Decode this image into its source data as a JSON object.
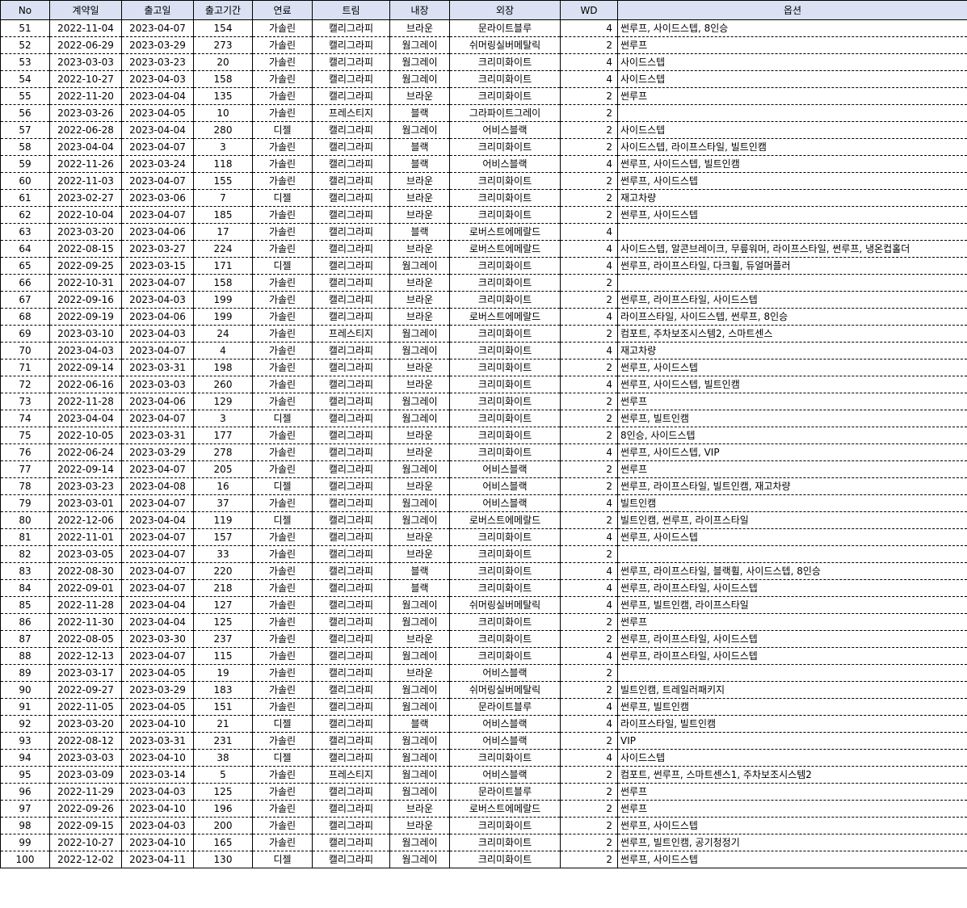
{
  "columns": [
    "No",
    "계약일",
    "출고일",
    "출고기간",
    "연료",
    "트림",
    "내장",
    "외장",
    "WD",
    "옵션"
  ],
  "rows": [
    [
      "51",
      "2022-11-04",
      "2023-04-07",
      "154",
      "가솔린",
      "캘리그라피",
      "브라운",
      "문라이트블루",
      "4",
      "썬루프, 사이드스텝, 8인승"
    ],
    [
      "52",
      "2022-06-29",
      "2023-03-29",
      "273",
      "가솔린",
      "캘리그라피",
      "웜그레이",
      "쉬머링실버메탈릭",
      "2",
      "썬루프"
    ],
    [
      "53",
      "2023-03-03",
      "2023-03-23",
      "20",
      "가솔린",
      "캘리그라피",
      "웜그레이",
      "크리미화이트",
      "4",
      "사이드스텝"
    ],
    [
      "54",
      "2022-10-27",
      "2023-04-03",
      "158",
      "가솔린",
      "캘리그라피",
      "웜그레이",
      "크리미화이트",
      "4",
      "사이드스텝"
    ],
    [
      "55",
      "2022-11-20",
      "2023-04-04",
      "135",
      "가솔린",
      "캘리그라피",
      "브라운",
      "크리미화이트",
      "2",
      "썬루프"
    ],
    [
      "56",
      "2023-03-26",
      "2023-04-05",
      "10",
      "가솔린",
      "프레스티지",
      "블랙",
      "그라파이트그레이",
      "2",
      ""
    ],
    [
      "57",
      "2022-06-28",
      "2023-04-04",
      "280",
      "디젤",
      "캘리그라피",
      "웜그레이",
      "어비스블랙",
      "2",
      "사이드스텝"
    ],
    [
      "58",
      "2023-04-04",
      "2023-04-07",
      "3",
      "가솔린",
      "캘리그라피",
      "블랙",
      "크리미화이트",
      "2",
      "사이드스텝, 라이프스타일, 빌트인캠"
    ],
    [
      "59",
      "2022-11-26",
      "2023-03-24",
      "118",
      "가솔린",
      "캘리그라피",
      "블랙",
      "어비스블랙",
      "4",
      "썬루프, 사이드스텝, 빌트인캠"
    ],
    [
      "60",
      "2022-11-03",
      "2023-04-07",
      "155",
      "가솔린",
      "캘리그라피",
      "브라운",
      "크리미화이트",
      "2",
      "썬루프, 사이드스텝"
    ],
    [
      "61",
      "2023-02-27",
      "2023-03-06",
      "7",
      "디젤",
      "캘리그라피",
      "브라운",
      "크리미화이트",
      "2",
      "재고차량"
    ],
    [
      "62",
      "2022-10-04",
      "2023-04-07",
      "185",
      "가솔린",
      "캘리그라피",
      "브라운",
      "크리미화이트",
      "2",
      "썬루프, 사이드스텝"
    ],
    [
      "63",
      "2023-03-20",
      "2023-04-06",
      "17",
      "가솔린",
      "캘리그라피",
      "블랙",
      "로버스트에메랄드",
      "4",
      ""
    ],
    [
      "64",
      "2022-08-15",
      "2023-03-27",
      "224",
      "가솔린",
      "캘리그라피",
      "브라운",
      "로버스트에메랄드",
      "4",
      "사이드스텝, 알콘브레이크, 무릎워머, 라이프스타일, 썬루프, 냉온컵홀더"
    ],
    [
      "65",
      "2022-09-25",
      "2023-03-15",
      "171",
      "디젤",
      "캘리그라피",
      "웜그레이",
      "크리미화이트",
      "4",
      "썬루프, 라이프스타일, 다크휠, 듀얼머플러"
    ],
    [
      "66",
      "2022-10-31",
      "2023-04-07",
      "158",
      "가솔린",
      "캘리그라피",
      "브라운",
      "크리미화이트",
      "2",
      ""
    ],
    [
      "67",
      "2022-09-16",
      "2023-04-03",
      "199",
      "가솔린",
      "캘리그라피",
      "브라운",
      "크리미화이트",
      "2",
      "썬루프, 라이프스타일, 사이드스텝"
    ],
    [
      "68",
      "2022-09-19",
      "2023-04-06",
      "199",
      "가솔린",
      "캘리그라피",
      "브라운",
      "로버스트에메랄드",
      "4",
      "라이프스타일, 사이드스텝, 썬루프, 8인승"
    ],
    [
      "69",
      "2023-03-10",
      "2023-04-03",
      "24",
      "가솔린",
      "프레스티지",
      "웜그레이",
      "크리미화이트",
      "2",
      "컴포트, 주차보조시스템2, 스마트센스"
    ],
    [
      "70",
      "2023-04-03",
      "2023-04-07",
      "4",
      "가솔린",
      "캘리그라피",
      "웜그레이",
      "크리미화이트",
      "4",
      "재고차량"
    ],
    [
      "71",
      "2022-09-14",
      "2023-03-31",
      "198",
      "가솔린",
      "캘리그라피",
      "브라운",
      "크리미화이트",
      "2",
      "썬루프, 사이드스텝"
    ],
    [
      "72",
      "2022-06-16",
      "2023-03-03",
      "260",
      "가솔린",
      "캘리그라피",
      "브라운",
      "크리미화이트",
      "4",
      "썬루프, 사이드스텝, 빌트인캠"
    ],
    [
      "73",
      "2022-11-28",
      "2023-04-06",
      "129",
      "가솔린",
      "캘리그라피",
      "웜그레이",
      "크리미화이트",
      "2",
      "썬루프"
    ],
    [
      "74",
      "2023-04-04",
      "2023-04-07",
      "3",
      "디젤",
      "캘리그라피",
      "웜그레이",
      "크리미화이트",
      "2",
      "썬루프, 빌트인캠"
    ],
    [
      "75",
      "2022-10-05",
      "2023-03-31",
      "177",
      "가솔린",
      "캘리그라피",
      "브라운",
      "크리미화이트",
      "2",
      "8인승, 사이드스텝"
    ],
    [
      "76",
      "2022-06-24",
      "2023-03-29",
      "278",
      "가솔린",
      "캘리그라피",
      "브라운",
      "크리미화이트",
      "4",
      "썬루프, 사이드스텝, VIP"
    ],
    [
      "77",
      "2022-09-14",
      "2023-04-07",
      "205",
      "가솔린",
      "캘리그라피",
      "웜그레이",
      "어비스블랙",
      "2",
      "썬루프"
    ],
    [
      "78",
      "2023-03-23",
      "2023-04-08",
      "16",
      "디젤",
      "캘리그라피",
      "브라운",
      "어비스블랙",
      "2",
      "썬루프, 라이프스타일, 빌트인캠, 재고차량"
    ],
    [
      "79",
      "2023-03-01",
      "2023-04-07",
      "37",
      "가솔린",
      "캘리그라피",
      "웜그레이",
      "어비스블랙",
      "4",
      "빌트인캠"
    ],
    [
      "80",
      "2022-12-06",
      "2023-04-04",
      "119",
      "디젤",
      "캘리그라피",
      "웜그레이",
      "로버스트에메랄드",
      "2",
      "빌트인캠, 썬루프, 라이프스타일"
    ],
    [
      "81",
      "2022-11-01",
      "2023-04-07",
      "157",
      "가솔린",
      "캘리그라피",
      "브라운",
      "크리미화이트",
      "4",
      "썬루프, 사이드스텝"
    ],
    [
      "82",
      "2023-03-05",
      "2023-04-07",
      "33",
      "가솔린",
      "캘리그라피",
      "브라운",
      "크리미화이트",
      "2",
      ""
    ],
    [
      "83",
      "2022-08-30",
      "2023-04-07",
      "220",
      "가솔린",
      "캘리그라피",
      "블랙",
      "크리미화이트",
      "4",
      "썬루프, 라이프스타일, 블랙휠, 사이드스텝, 8인승"
    ],
    [
      "84",
      "2022-09-01",
      "2023-04-07",
      "218",
      "가솔린",
      "캘리그라피",
      "블랙",
      "크리미화이트",
      "4",
      "썬루프, 라이프스타일, 사이드스텝"
    ],
    [
      "85",
      "2022-11-28",
      "2023-04-04",
      "127",
      "가솔린",
      "캘리그라피",
      "웜그레이",
      "쉬머링실버메탈릭",
      "4",
      "썬루프, 빌트인캠, 라이프스타일"
    ],
    [
      "86",
      "2022-11-30",
      "2023-04-04",
      "125",
      "가솔린",
      "캘리그라피",
      "웜그레이",
      "크리미화이트",
      "2",
      "썬루프"
    ],
    [
      "87",
      "2022-08-05",
      "2023-03-30",
      "237",
      "가솔린",
      "캘리그라피",
      "브라운",
      "크리미화이트",
      "2",
      "썬루프, 라이프스타일, 사이드스텝"
    ],
    [
      "88",
      "2022-12-13",
      "2023-04-07",
      "115",
      "가솔린",
      "캘리그라피",
      "웜그레이",
      "크리미화이트",
      "4",
      "썬루프, 라이프스타일, 사이드스텝"
    ],
    [
      "89",
      "2023-03-17",
      "2023-04-05",
      "19",
      "가솔린",
      "캘리그라피",
      "브라운",
      "어비스블랙",
      "2",
      ""
    ],
    [
      "90",
      "2022-09-27",
      "2023-03-29",
      "183",
      "가솔린",
      "캘리그라피",
      "웜그레이",
      "쉬머링실버메탈릭",
      "2",
      "빌트인캠, 트레일러패키지"
    ],
    [
      "91",
      "2022-11-05",
      "2023-04-05",
      "151",
      "가솔린",
      "캘리그라피",
      "웜그레이",
      "문라이트블루",
      "4",
      "썬루프, 빌트인캠"
    ],
    [
      "92",
      "2023-03-20",
      "2023-04-10",
      "21",
      "디젤",
      "캘리그라피",
      "블랙",
      "어비스블랙",
      "4",
      "라이프스타일, 빌트인캠"
    ],
    [
      "93",
      "2022-08-12",
      "2023-03-31",
      "231",
      "가솔린",
      "캘리그라피",
      "웜그레이",
      "어비스블랙",
      "2",
      "VIP"
    ],
    [
      "94",
      "2023-03-03",
      "2023-04-10",
      "38",
      "디젤",
      "캘리그라피",
      "웜그레이",
      "크리미화이트",
      "4",
      "사이드스텝"
    ],
    [
      "95",
      "2023-03-09",
      "2023-03-14",
      "5",
      "가솔린",
      "프레스티지",
      "웜그레이",
      "어비스블랙",
      "2",
      "컴포트, 썬루프, 스마트센스1, 주차보조시스템2"
    ],
    [
      "96",
      "2022-11-29",
      "2023-04-03",
      "125",
      "가솔린",
      "캘리그라피",
      "웜그레이",
      "문라이트블루",
      "2",
      "썬루프"
    ],
    [
      "97",
      "2022-09-26",
      "2023-04-10",
      "196",
      "가솔린",
      "캘리그라피",
      "브라운",
      "로버스트에메랄드",
      "2",
      "썬루프"
    ],
    [
      "98",
      "2022-09-15",
      "2023-04-03",
      "200",
      "가솔린",
      "캘리그라피",
      "브라운",
      "크리미화이트",
      "2",
      "썬루프, 사이드스텝"
    ],
    [
      "99",
      "2022-10-27",
      "2023-04-10",
      "165",
      "가솔린",
      "캘리그라피",
      "웜그레이",
      "크리미화이트",
      "2",
      "썬루프, 빌트인캠, 공기청정기"
    ],
    [
      "100",
      "2022-12-02",
      "2023-04-11",
      "130",
      "디젤",
      "캘리그라피",
      "웜그레이",
      "크리미화이트",
      "2",
      "썬루프, 사이드스텝"
    ]
  ]
}
